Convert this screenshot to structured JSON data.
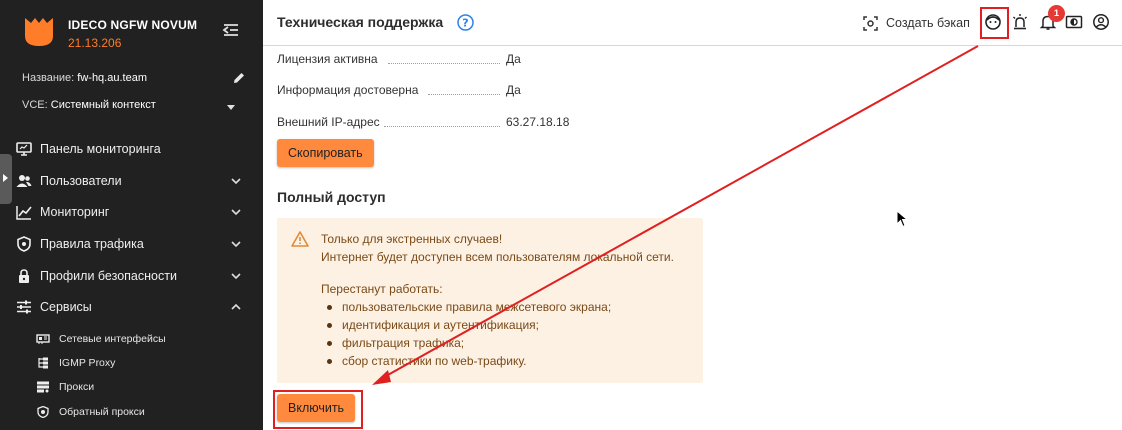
{
  "brand": {
    "name": "IDECO NGFW NOVUM",
    "version": "21.13.206"
  },
  "sidebar_meta": {
    "name_label": "Название:",
    "name_value": "fw-hq.au.team",
    "vce_label": "VCE:",
    "vce_value": "Системный контекст"
  },
  "nav": [
    {
      "label": "Панель мониторинга",
      "icon": "monitor-icon"
    },
    {
      "label": "Пользователи",
      "icon": "users-icon"
    },
    {
      "label": "Мониторинг",
      "icon": "chart-line-icon"
    },
    {
      "label": "Правила трафика",
      "icon": "shield-icon"
    },
    {
      "label": "Профили безопасности",
      "icon": "lock-icon"
    },
    {
      "label": "Сервисы",
      "icon": "sliders-icon"
    }
  ],
  "services_sub": [
    {
      "label": "Сетевые интерфейсы",
      "icon": "network-card-icon"
    },
    {
      "label": "IGMP Proxy",
      "icon": "tree-icon"
    },
    {
      "label": "Прокси",
      "icon": "server-icon"
    },
    {
      "label": "Обратный прокси",
      "icon": "shield-gear-icon"
    }
  ],
  "topbar": {
    "title": "Техническая поддержка",
    "backup_label": "Создать бэкап",
    "notifications_count": "1"
  },
  "license": {
    "rows": [
      {
        "label": "Лицензия активна",
        "value": "Да"
      },
      {
        "label": "Информация достоверна",
        "value": "Да"
      },
      {
        "label": "Внешний IP-адрес",
        "value": "63.27.18.18"
      }
    ],
    "copy_button": "Скопировать"
  },
  "full_access": {
    "title": "Полный доступ",
    "warning_line1": "Только для экстренных случаев!",
    "warning_line2": "Интернет будет доступен всем пользователям локальной сети.",
    "stop_title": "Перестанут работать:",
    "stop_items": [
      "пользовательские правила межсетевого экрана;",
      "идентификация и аутентификация;",
      "фильтрация трафика;",
      "сбор статистики по web-трафику."
    ],
    "enable_button": "Включить"
  },
  "colors": {
    "accent": "#ff8a3d",
    "sidebar": "#212121",
    "warning_bg": "#fdf1e4",
    "highlight": "#e02020"
  }
}
